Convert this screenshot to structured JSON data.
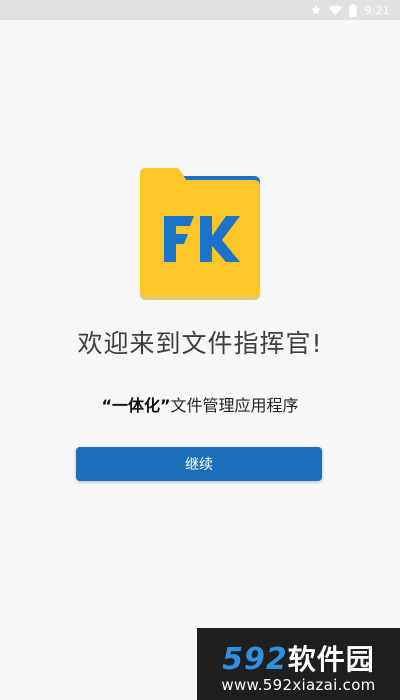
{
  "status_bar": {
    "time": "9:21",
    "icons": [
      "star-icon",
      "wifi-icon",
      "battery-icon"
    ]
  },
  "logo": {
    "letters": "FK",
    "icon": "folder-icon",
    "folder_color": "#FFC629",
    "tab_color": "#1A73C8",
    "letter_color": "#1A73C8"
  },
  "welcome": {
    "title": "欢迎来到文件指挥官!"
  },
  "subtitle": {
    "bold_part": "“一体化”",
    "rest": "文件管理应用程序"
  },
  "continue_button": {
    "label": "继续",
    "color": "#1A6FB8"
  },
  "watermark": {
    "brand_digits": "592",
    "brand_text": "软件园",
    "url": "www.592xiazai.com"
  }
}
